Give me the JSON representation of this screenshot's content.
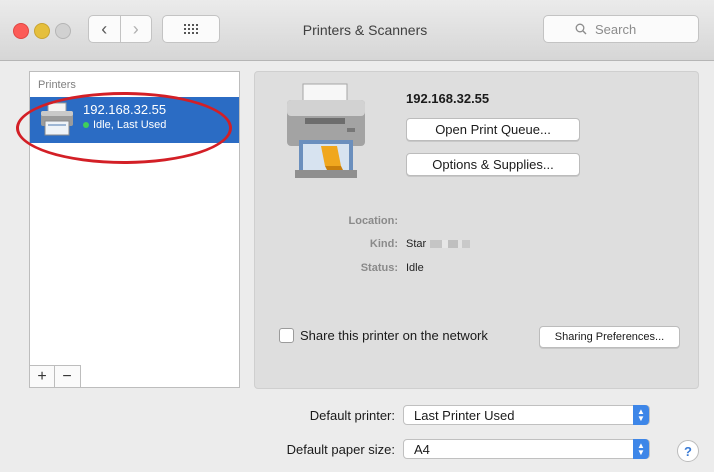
{
  "window": {
    "title": "Printers & Scanners"
  },
  "toolbar": {
    "back_glyph": "‹",
    "forward_glyph": "›",
    "search_placeholder": "Search"
  },
  "sidebar": {
    "header": "Printers",
    "items": [
      {
        "name": "192.168.32.55",
        "status": "Idle, Last Used"
      }
    ],
    "add_label": "+",
    "remove_label": "−"
  },
  "detail": {
    "printer_name": "192.168.32.55",
    "open_queue_label": "Open Print Queue...",
    "options_label": "Options & Supplies...",
    "location_label": "Location:",
    "location_value": "",
    "kind_label": "Kind:",
    "kind_value": "Star",
    "status_label": "Status:",
    "status_value": "Idle",
    "share_label": "Share this printer on the network",
    "share_checked": false,
    "sharing_prefs_label": "Sharing Preferences..."
  },
  "defaults": {
    "printer_label": "Default printer:",
    "printer_value": "Last Printer Used",
    "paper_label": "Default paper size:",
    "paper_value": "A4"
  },
  "help_label": "?",
  "colors": {
    "selection": "#2b6cc4",
    "annotation": "#d31f26",
    "status_dot": "#3fcf5b",
    "popup_accent": "#3d86e8"
  }
}
